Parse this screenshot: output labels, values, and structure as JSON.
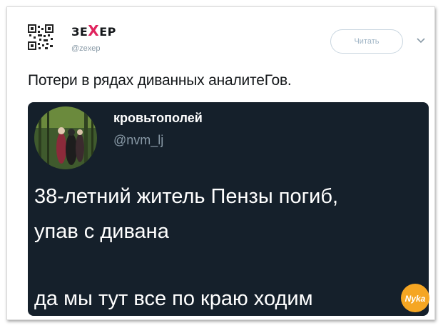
{
  "tweet": {
    "author_name_part1": "ЗЕ",
    "author_name_x": "X",
    "author_name_part2": "ЕР",
    "author_handle": "@zexep",
    "follow_label": "Читать",
    "text": "Потери в рядах диванных аналитеГов."
  },
  "quoted": {
    "name": "кровьтополей",
    "handle": "@nvm_lj",
    "lines": [
      "38-летний житель Пензы погиб,",
      "упав с дивана",
      "да мы тут все по краю ходим"
    ]
  },
  "watermark": {
    "text": "Nyka"
  },
  "colors": {
    "accent_x": "#e0245e",
    "dark_bg": "#15202b",
    "watermark_bg": "#f5a623"
  }
}
